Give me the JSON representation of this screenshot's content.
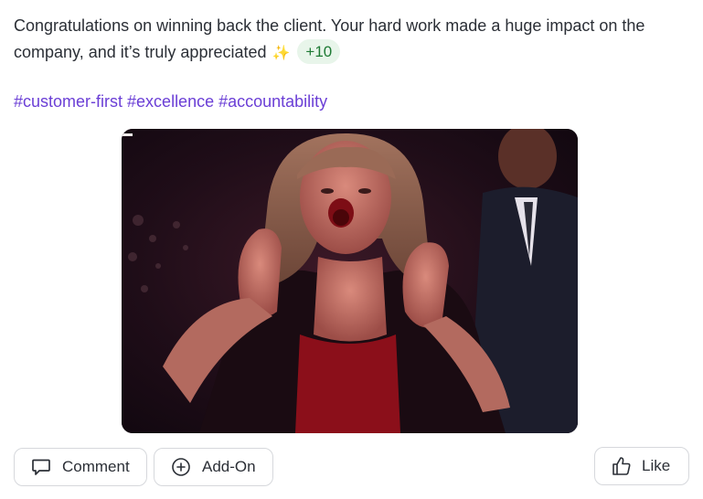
{
  "post": {
    "message": "Congratulations on winning back the client. Your hard work made a huge impact on the company, and it’s truly appreciated",
    "sparkle_icon": "sparkles-icon",
    "points_badge": "+10",
    "hashtags": [
      "#customer-first",
      "#excellence",
      "#accountability"
    ]
  },
  "media": {
    "type": "animated-gif",
    "icon": "gif-image"
  },
  "actions": {
    "comment_label": "Comment",
    "comment_icon": "comment-icon",
    "addon_label": "Add-On",
    "addon_icon": "plus-circle-icon",
    "like_label": "Like",
    "like_icon": "thumbs-up-icon"
  },
  "colors": {
    "hashtag": "#6b3fd6",
    "points_bg": "#e8f5ea",
    "points_text": "#1e7a34",
    "border": "#d6d8dc"
  }
}
